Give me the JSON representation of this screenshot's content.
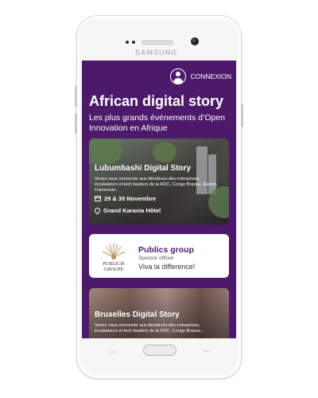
{
  "device": {
    "brand": "SAMSUNG"
  },
  "header": {
    "login_label": "CONNEXION",
    "title": "African digital story",
    "subtitle": "Les plus grands événements d’Open Innovation en Afrique"
  },
  "events": [
    {
      "title": "Lubumbashi Digital Story",
      "description": "Venez vous connecter aux décideurs des entreprises, incubateurs et tech leaders de la RDC, Congo Brazza, Gabon, Cameroun...",
      "date": "29 & 30 Novembre",
      "venue": "Grand Karavia Hôtel"
    },
    {
      "title": "Bruxelles Digital Story",
      "description": "Venez vous connecter aux décideurs des entreprises, incubateurs et tech leaders de la RDC, Congo Brazza..."
    }
  ],
  "sponsor": {
    "logo_line1": "PUBLICIS",
    "logo_line2": "GROUPE",
    "name": "Publics group",
    "tag": "Sponsor officiel",
    "slogan": "Viva la difference!"
  },
  "colors": {
    "brand_purple": "#4d1a6b",
    "white": "#ffffff"
  },
  "icons": [
    "user-icon",
    "calendar-icon",
    "location-pin-icon"
  ]
}
